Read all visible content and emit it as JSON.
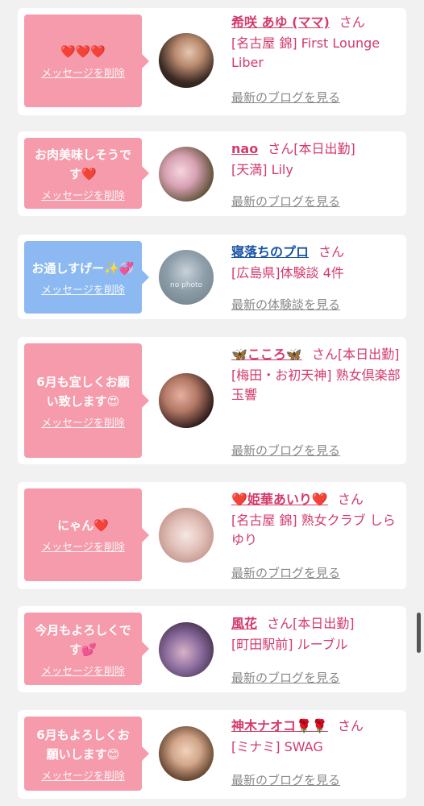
{
  "cards": [
    {
      "message": "❤️❤️❤️",
      "delete_label": "メッセージを削除",
      "name": "希咲 あゆ (ママ)",
      "san": "さん",
      "status": "",
      "shop": "[名古屋 錦] First Lounge Liber",
      "blog_link": "最新のブログを見る"
    },
    {
      "message": "お肉美味しそうです❤️",
      "delete_label": "メッセージを削除",
      "name": "nao",
      "san": "さん",
      "status": "[本日出勤]",
      "shop": "[天満] Lily",
      "blog_link": "最新のブログを見る"
    },
    {
      "message": "お通しすげー✨💞",
      "delete_label": "メッセージを削除",
      "name": "寝落ちのプロ",
      "san": "さん",
      "status": "",
      "shop": "[広島県]体験談 4件",
      "blog_link": "最新の体験談を見る",
      "avatar_text": "no photo"
    },
    {
      "message": "6月も宜しくお願い致します😍",
      "delete_label": "メッセージを削除",
      "name": "🦋こころ🦋",
      "san": "さん",
      "status": "[本日出勤]",
      "shop": "[梅田・お初天神] 熟女倶楽部 玉響",
      "blog_link": "最新のブログを見る"
    },
    {
      "message": "にゃん❤️",
      "delete_label": "メッセージを削除",
      "name": "❤️姫華あいり❤️",
      "san": "さん",
      "status": "",
      "shop": "[名古屋 錦] 熟女クラブ しらゆり",
      "blog_link": "最新のブログを見る"
    },
    {
      "message": "今月もよろしくです💕",
      "delete_label": "メッセージを削除",
      "name": "風花",
      "san": "さん",
      "status": "[本日出勤]",
      "shop": "[町田駅前] ルーブル",
      "blog_link": "最新のブログを見る"
    },
    {
      "message": "6月もよろしくお願いします😊",
      "delete_label": "メッセージを削除",
      "name": "神木ナオコ🌹🌹",
      "san": "さん",
      "status": "",
      "shop": "[ミナミ] SWAG",
      "blog_link": "最新のブログを見る"
    }
  ],
  "colors": {
    "pink_bubble": "#f59bab",
    "blue_bubble": "#8db9f2",
    "name_pink": "#d43a6a",
    "name_blue": "#1b55a6",
    "link_gray": "#888888"
  }
}
